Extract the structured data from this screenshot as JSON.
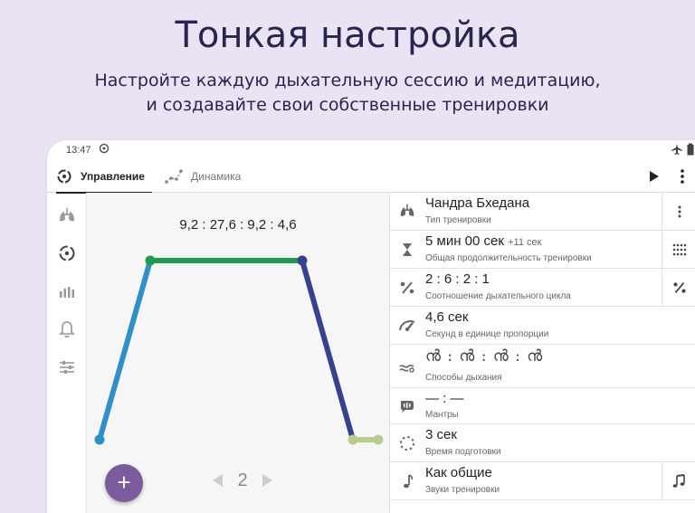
{
  "promo": {
    "title": "Тонкая настройка",
    "subtitle_line1": "Настройте каждую дыхательную сессию и медитацию,",
    "subtitle_line2": "и создавайте свои собственные тренировки"
  },
  "status_bar": {
    "time": "13:47"
  },
  "tabs": [
    {
      "label": "Управление",
      "active": true,
      "icon": "breath-cycle-icon"
    },
    {
      "label": "Динамика",
      "active": false,
      "icon": "dynamics-chart-icon"
    }
  ],
  "toolbar": {
    "play_icon": "play-icon",
    "more_icon": "more-vert-icon"
  },
  "siderail": {
    "items": [
      {
        "icon": "lungs-icon"
      },
      {
        "icon": "breath-cycle-icon"
      },
      {
        "icon": "bar-chart-icon"
      },
      {
        "icon": "bell-icon"
      },
      {
        "icon": "sliders-icon"
      }
    ]
  },
  "graph": {
    "ratio_text": "9,2 : 27,6 : 9,2 : 4,6",
    "page_number": "2",
    "phases": [
      {
        "name": "inhale",
        "duration": 9.2,
        "color": "#2f8fc8"
      },
      {
        "name": "hold",
        "duration": 27.6,
        "color": "#1f9a55"
      },
      {
        "name": "exhale",
        "duration": 9.2,
        "color": "#35438f"
      },
      {
        "name": "hold_after",
        "duration": 4.6,
        "color": "#b8cc8e"
      }
    ]
  },
  "fab": {
    "label": "+"
  },
  "settings": {
    "rows": [
      {
        "icon": "lungs-icon",
        "value": "Чандра Бхедана",
        "label": "Тип тренировки",
        "action_icon": "more-vert-icon"
      },
      {
        "icon": "hourglass-icon",
        "value": "5 мин 00 сек",
        "extra": "+11 сек",
        "label": "Общая продолжительность тренировки",
        "action_icon": "dots-grid-icon"
      },
      {
        "icon": "percent-icon",
        "value": "2 : 6 : 2 : 1",
        "label": "Соотношение дыхательного цикла",
        "action_icon": "percent-icon"
      },
      {
        "icon": "speedometer-icon",
        "value": "4,6 сек",
        "label": "Секунд в единице пропорции",
        "action_icon": ""
      },
      {
        "icon": "breathing-methods-icon",
        "value": "ൻ : ൻ : ൻ : ൻ",
        "label": "Способы дыхания",
        "action_icon": ""
      },
      {
        "icon": "mantra-icon",
        "value": "— : —",
        "label": "Мантры",
        "action_icon": ""
      },
      {
        "icon": "spinner-icon",
        "value": "3 сек",
        "label": "Время подготовки",
        "action_icon": ""
      },
      {
        "icon": "music-note-icon",
        "value": "Как общие",
        "label": "Звуки тренировки",
        "action_icon": "music-notes-icon"
      }
    ]
  }
}
